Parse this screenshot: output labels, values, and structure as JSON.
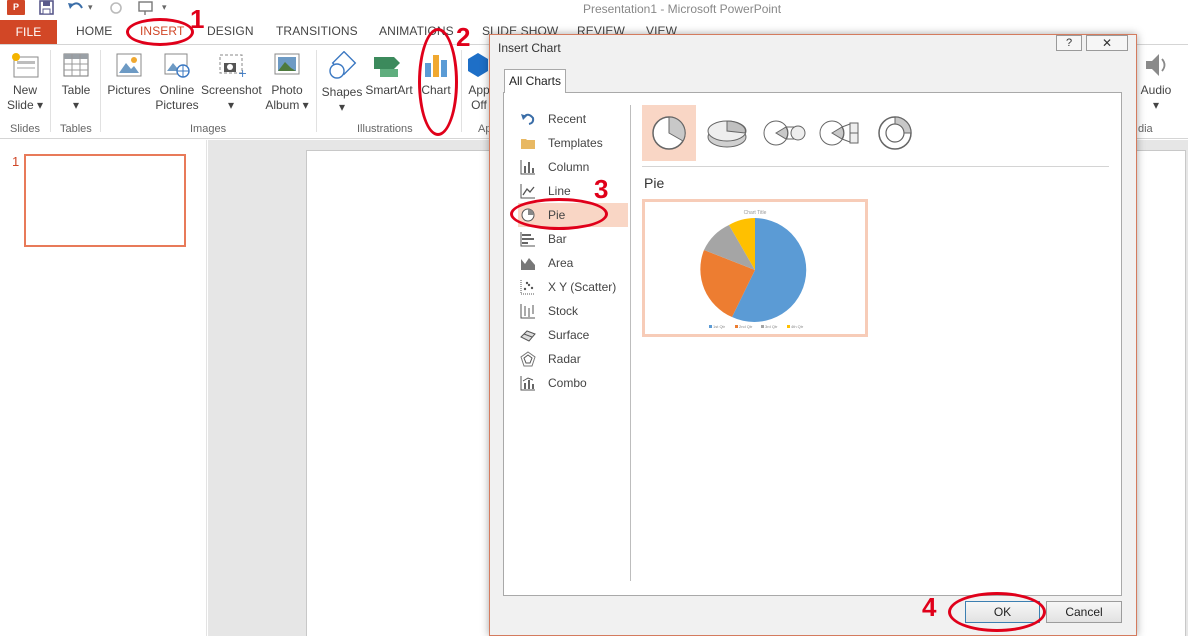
{
  "window": {
    "title": "Presentation1 - Microsoft PowerPoint"
  },
  "app_logo": "P",
  "tabs": [
    {
      "label": "FILE"
    },
    {
      "label": "HOME"
    },
    {
      "label": "INSERT"
    },
    {
      "label": "DESIGN"
    },
    {
      "label": "TRANSITIONS"
    },
    {
      "label": "ANIMATIONS"
    },
    {
      "label": "SLIDE SHOW"
    },
    {
      "label": "REVIEW"
    },
    {
      "label": "VIEW"
    }
  ],
  "ribbon": {
    "new_slide": {
      "line1": "New",
      "line2": "Slide"
    },
    "table": "Table",
    "pictures": "Pictures",
    "online_pictures": {
      "line1": "Online",
      "line2": "Pictures"
    },
    "screenshot": "Screenshot",
    "photo_album": {
      "line1": "Photo",
      "line2": "Album"
    },
    "shapes": "Shapes",
    "smartart": "SmartArt",
    "chart": "Chart",
    "apps": {
      "line1": "App",
      "line2": "Off"
    },
    "audio": "Audio",
    "groups": {
      "slides": "Slides",
      "tables": "Tables",
      "images": "Images",
      "illustrations": "Illustrations",
      "apps": "Ap",
      "media": "dia"
    }
  },
  "slides_pane": {
    "slide_number": "1"
  },
  "dialog": {
    "title": "Insert Chart",
    "help": "?",
    "close": "✕",
    "tab": "All Charts",
    "chart_types": [
      {
        "label": "Recent",
        "icon": "recent-icon"
      },
      {
        "label": "Templates",
        "icon": "folder-icon"
      },
      {
        "label": "Column",
        "icon": "column-chart-icon"
      },
      {
        "label": "Line",
        "icon": "line-chart-icon"
      },
      {
        "label": "Pie",
        "icon": "pie-chart-icon",
        "selected": true
      },
      {
        "label": "Bar",
        "icon": "bar-chart-icon"
      },
      {
        "label": "Area",
        "icon": "area-chart-icon"
      },
      {
        "label": "X Y (Scatter)",
        "icon": "scatter-chart-icon"
      },
      {
        "label": "Stock",
        "icon": "stock-chart-icon"
      },
      {
        "label": "Surface",
        "icon": "surface-chart-icon"
      },
      {
        "label": "Radar",
        "icon": "radar-chart-icon"
      },
      {
        "label": "Combo",
        "icon": "combo-chart-icon"
      }
    ],
    "subtypes": [
      "pie",
      "3d-pie",
      "pie-of-pie",
      "bar-of-pie",
      "doughnut"
    ],
    "selected_heading": "Pie",
    "preview": {
      "chart_title": "Chart Title",
      "legend": [
        "1st Qtr",
        "2nd Qtr",
        "3rd Qtr",
        "4th Qtr"
      ],
      "colors": [
        "#5b9bd5",
        "#ed7d31",
        "#a5a5a5",
        "#ffc000"
      ]
    },
    "ok_label": "OK",
    "cancel_label": "Cancel"
  },
  "annotations": [
    "1",
    "2",
    "3",
    "4"
  ],
  "accent_color": "#d24726"
}
